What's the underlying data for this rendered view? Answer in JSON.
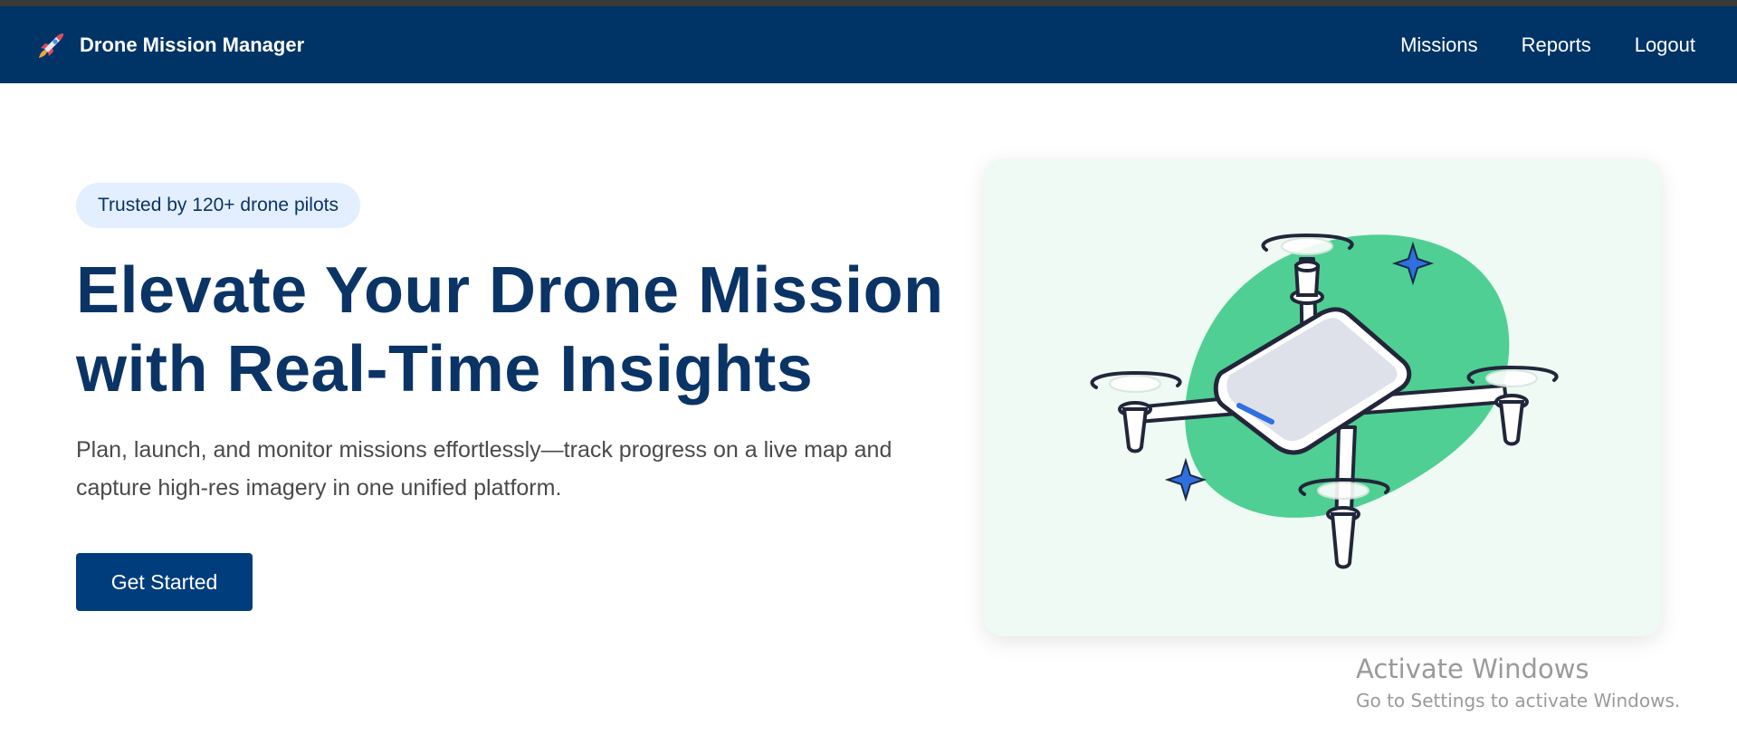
{
  "app": {
    "name": "Drone Mission Manager",
    "logo_icon": "rocket-icon"
  },
  "nav": {
    "links": [
      "Missions",
      "Reports",
      "Logout"
    ]
  },
  "hero": {
    "badge": "Trusted by 120+ drone pilots",
    "headline_line1": "Elevate Your Drone Mission",
    "headline_line2": "with Real-Time Insights",
    "subtext": "Plan, launch, and monitor missions effortlessly—track progress on a live map and capture high-res imagery in one unified platform.",
    "cta_label": "Get Started",
    "illustration_icon": "drone-icon"
  },
  "watermark": {
    "title": "Activate Windows",
    "subtitle": "Go to Settings to activate Windows."
  },
  "colors": {
    "navbar": "#003366",
    "heading": "#0b3466",
    "cta": "#003d7c",
    "badge_bg": "#e3efff",
    "card_bg": "#eefaf3",
    "blob": "#4fcf93",
    "sparkle": "#2f6fe0"
  }
}
